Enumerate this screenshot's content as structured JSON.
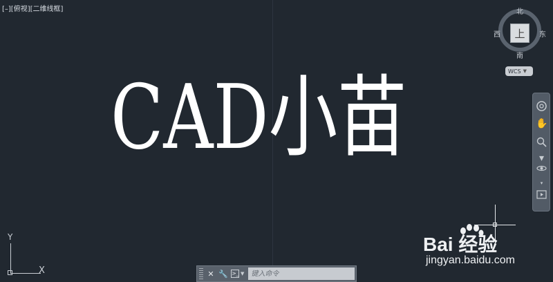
{
  "viewport": {
    "label": "[–][俯视][二维线框]",
    "drawing_text": "CAD小苗"
  },
  "viewcube": {
    "top_face": "上",
    "north": "北",
    "south": "南",
    "west": "西",
    "east": "东",
    "wcs_label": "WCS"
  },
  "navbar": {
    "icons": [
      "steering-wheel-icon",
      "pan-hand-icon",
      "zoom-icon",
      "orbit-icon",
      "showmotion-icon"
    ]
  },
  "ucs": {
    "x_label": "X",
    "y_label": "Y"
  },
  "command_line": {
    "placeholder": "键入命令"
  },
  "watermark": {
    "brand": "Bai  经验",
    "url": "jingyan.baidu.com"
  }
}
